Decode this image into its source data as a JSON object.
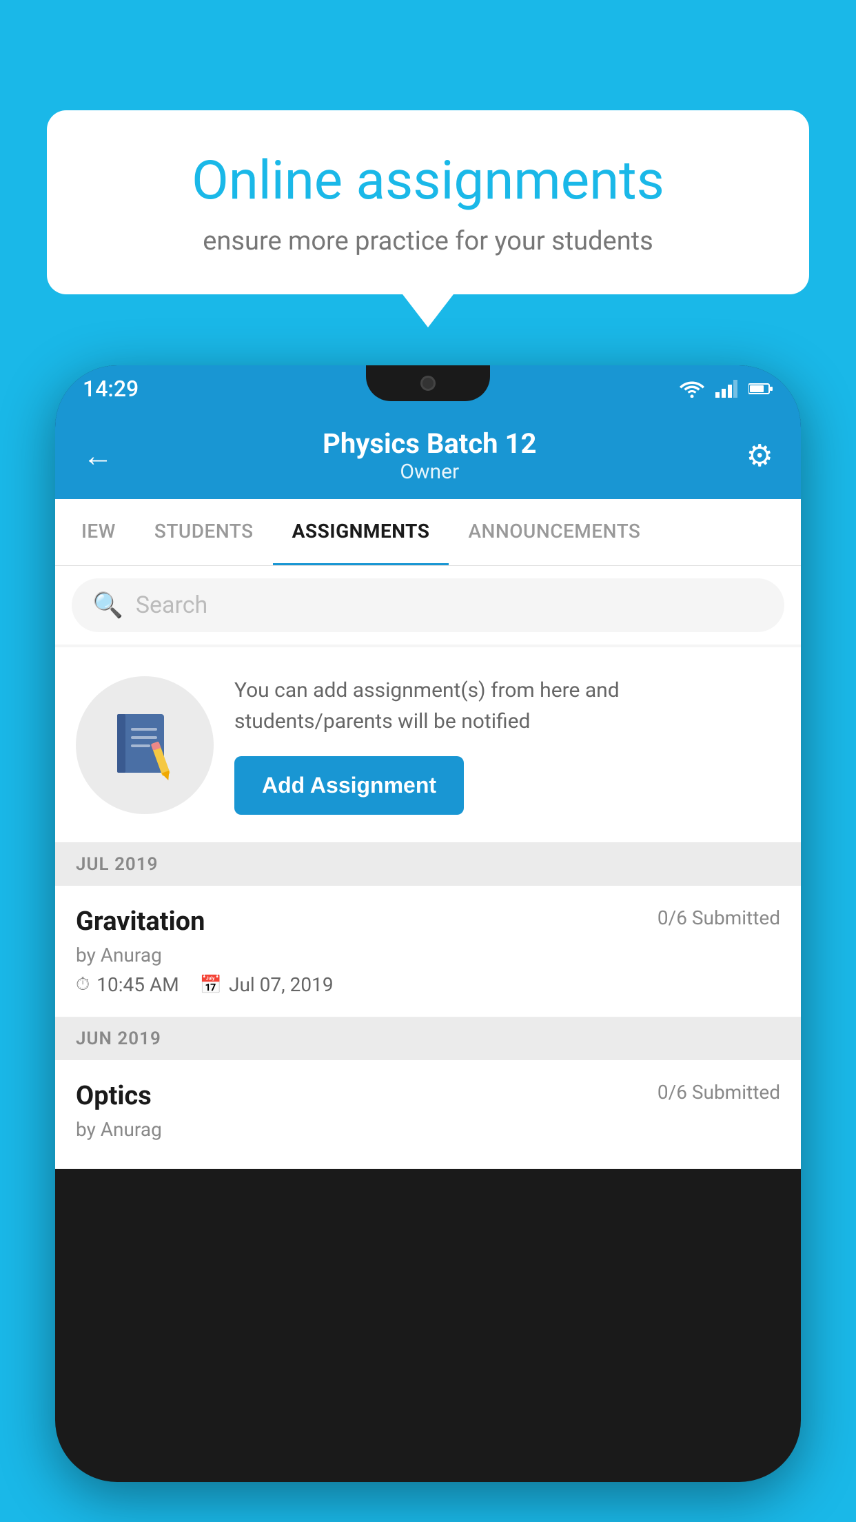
{
  "background_color": "#1ab8e8",
  "speech_bubble": {
    "title": "Online assignments",
    "subtitle": "ensure more practice for your students"
  },
  "phone": {
    "status_bar": {
      "time": "14:29"
    },
    "header": {
      "title": "Physics Batch 12",
      "subtitle": "Owner",
      "back_label": "←",
      "settings_label": "⚙"
    },
    "tabs": [
      {
        "label": "IEW",
        "active": false
      },
      {
        "label": "STUDENTS",
        "active": false
      },
      {
        "label": "ASSIGNMENTS",
        "active": true
      },
      {
        "label": "ANNOUNCEMENTS",
        "active": false
      }
    ],
    "search": {
      "placeholder": "Search"
    },
    "promo": {
      "text": "You can add assignment(s) from here and students/parents will be notified",
      "button_label": "Add Assignment"
    },
    "sections": [
      {
        "header": "JUL 2019",
        "assignments": [
          {
            "name": "Gravitation",
            "submitted": "0/6 Submitted",
            "author": "by Anurag",
            "time": "10:45 AM",
            "date": "Jul 07, 2019"
          }
        ]
      },
      {
        "header": "JUN 2019",
        "assignments": [
          {
            "name": "Optics",
            "submitted": "0/6 Submitted",
            "author": "by Anurag",
            "time": "",
            "date": ""
          }
        ]
      }
    ]
  }
}
